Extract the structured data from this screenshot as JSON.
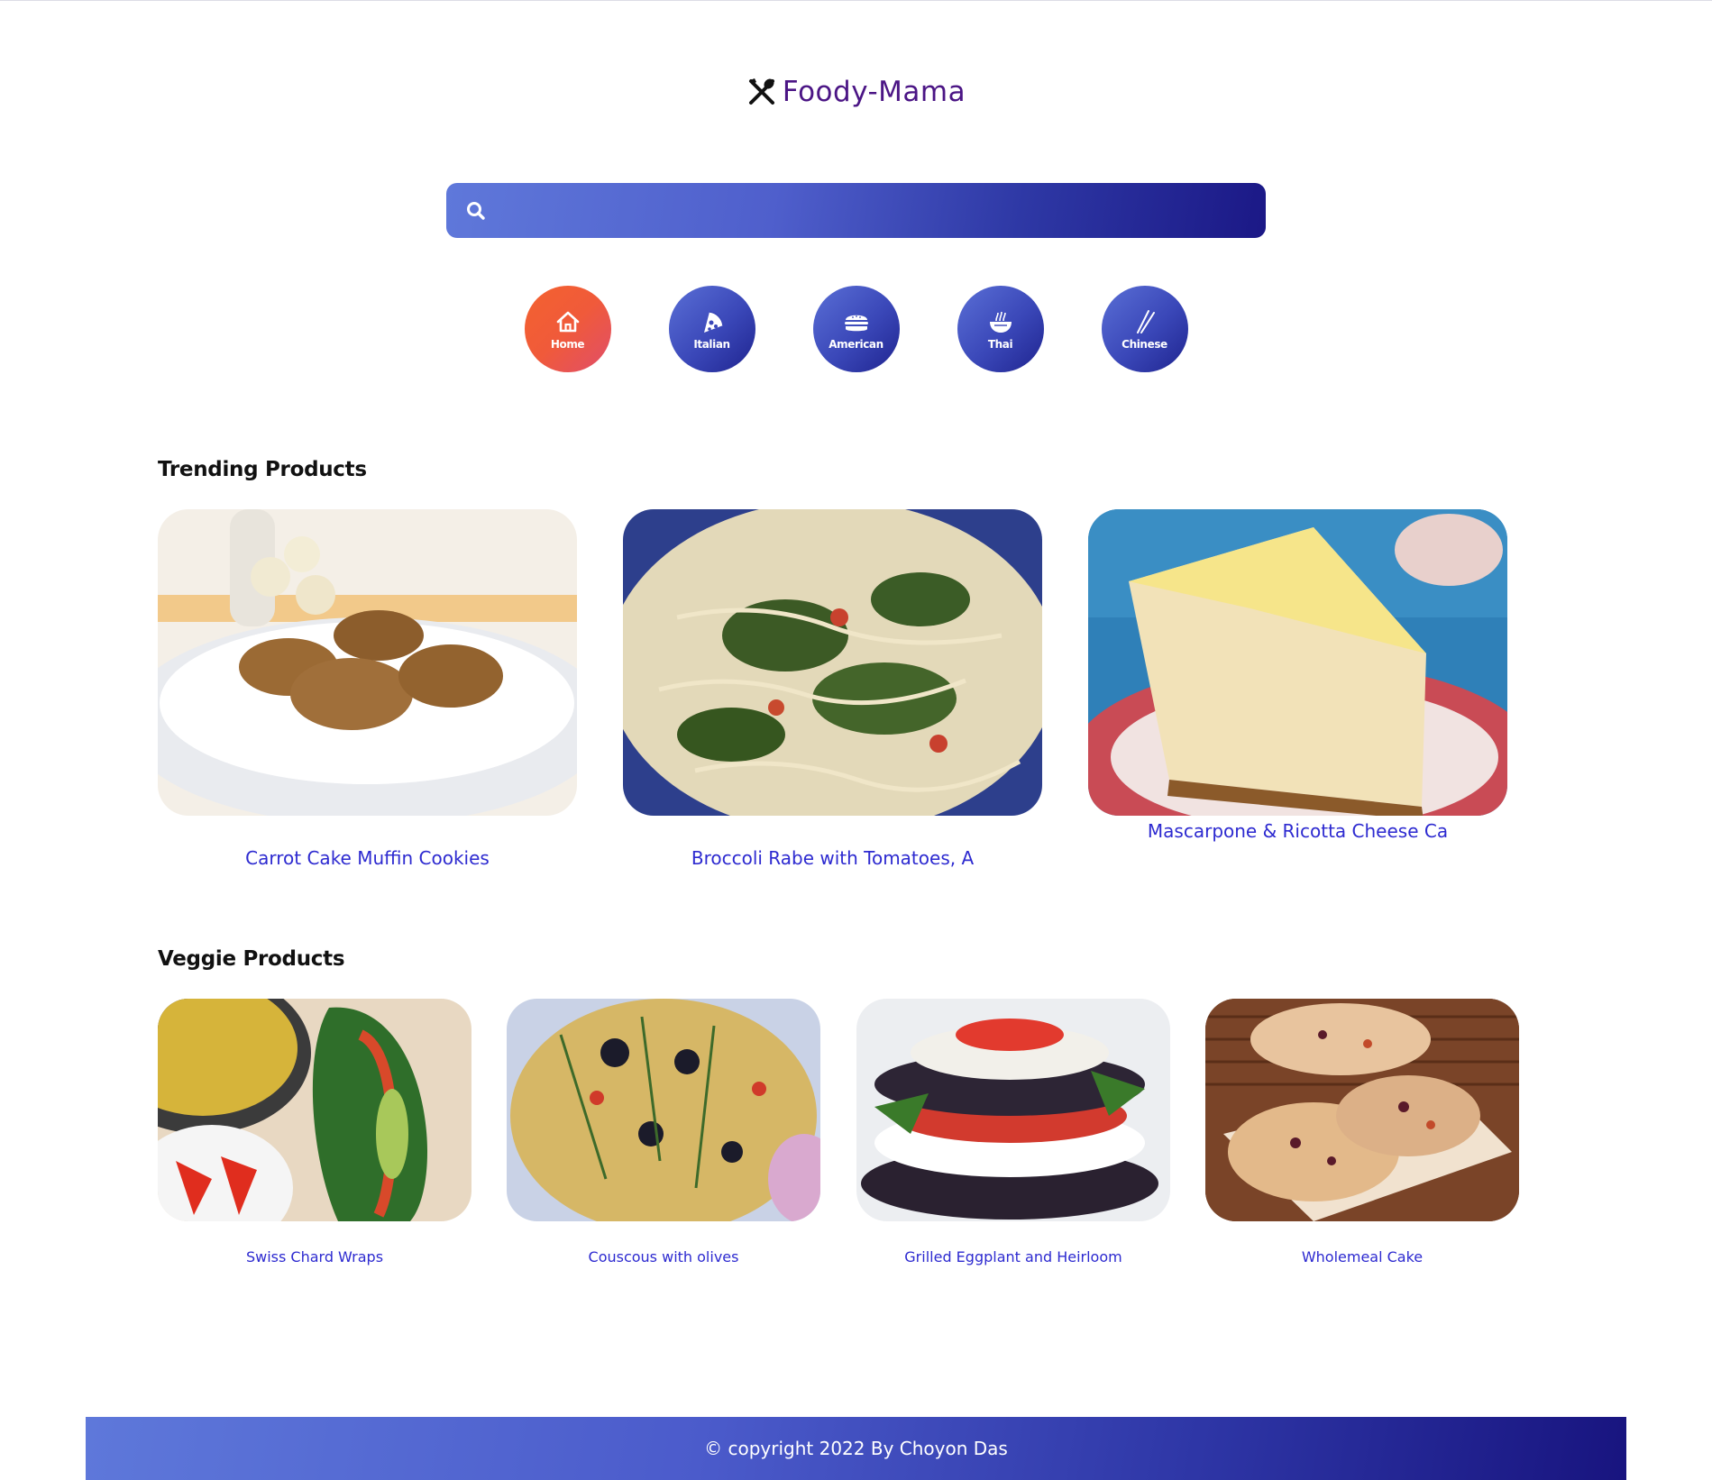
{
  "brand": {
    "name": "Foody-Mama",
    "icon": "utensils-icon",
    "color": "#4b1585"
  },
  "search": {
    "placeholder": "",
    "value": "",
    "icon": "search-icon"
  },
  "categories": [
    {
      "label": "Home",
      "icon": "home-icon",
      "active": true
    },
    {
      "label": "Italian",
      "icon": "pizza-icon",
      "active": false
    },
    {
      "label": "American",
      "icon": "burger-icon",
      "active": false
    },
    {
      "label": "Thai",
      "icon": "noodle-bowl-icon",
      "active": false
    },
    {
      "label": "Chinese",
      "icon": "chopsticks-icon",
      "active": false
    }
  ],
  "trending": {
    "title": "Trending Products",
    "items": [
      {
        "title": "Carrot Cake Muffin Cookies",
        "image": "carrot-cake-muffin-cookies-photo"
      },
      {
        "title": "Broccoli Rabe with Tomatoes, A",
        "image": "broccoli-rabe-pasta-photo"
      },
      {
        "title": "Mascarpone & Ricotta Cheese Ca",
        "image": "cheesecake-slice-photo"
      }
    ]
  },
  "veggie": {
    "title": "Veggie Products",
    "items": [
      {
        "title": "Swiss Chard Wraps",
        "image": "swiss-chard-wraps-photo"
      },
      {
        "title": "Couscous with olives",
        "image": "couscous-olives-photo"
      },
      {
        "title": "Grilled Eggplant and Heirloom",
        "image": "grilled-eggplant-stack-photo"
      },
      {
        "title": "Wholemeal Cake",
        "image": "wholemeal-cake-photo"
      }
    ]
  },
  "footer": {
    "text": "© copyright 2022 By Choyon Das"
  },
  "colors": {
    "accent": "#2d2ad0",
    "active_category": "#f4622f",
    "gradient_start": "#5f78da",
    "gradient_end": "#1b1886"
  }
}
